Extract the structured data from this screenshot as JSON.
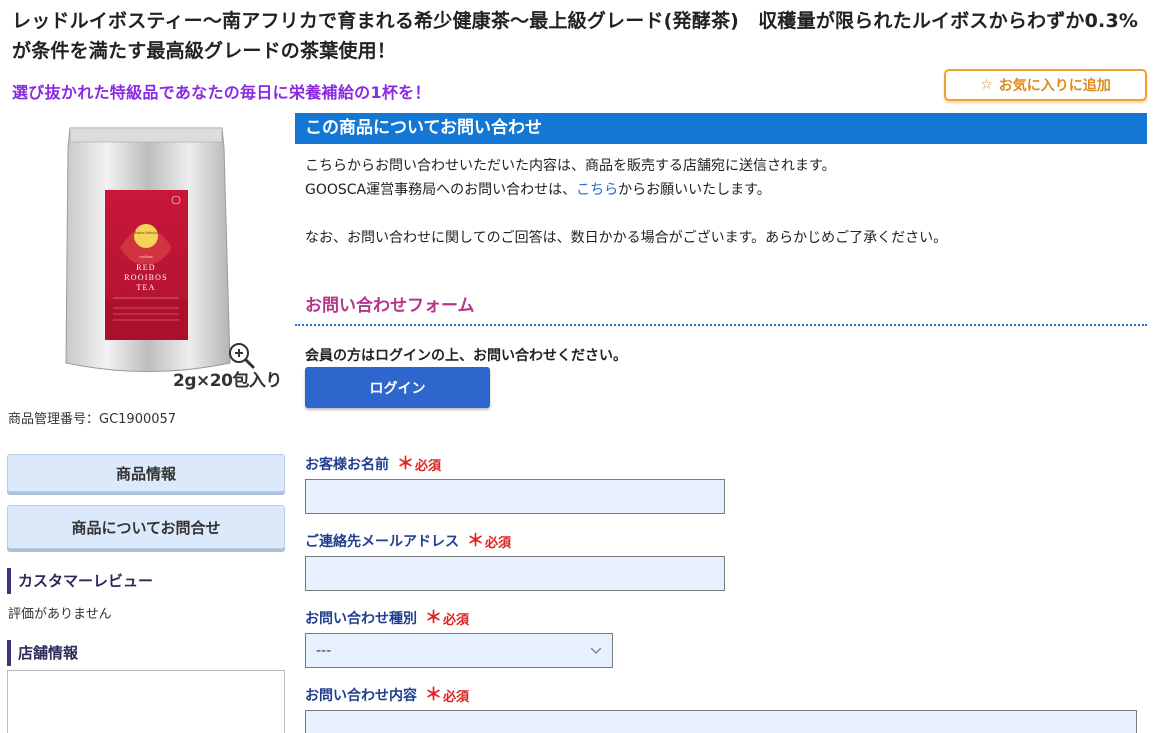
{
  "product": {
    "title": "レッドルイボスティー〜南アフリカで育まれる希少健康茶〜最上級グレード(発酵茶)　収穫量が限られたルイボスからわずか0.3%が条件を満たす最高級グレードの茶葉使用！",
    "catch_copy": "選び抜かれた特級品であなたの毎日に栄養補給の1杯を！",
    "management_no": "商品管理番号：GC1900057",
    "package": {
      "badge": "Masters Selection",
      "series": "rooibos",
      "line1": "RED",
      "line2": "ROOIBOS",
      "line3": "TEA",
      "count_label": "2g×20包入り"
    }
  },
  "favorite_button": {
    "icon": "star-outline-icon",
    "label": "お気に入りに追加"
  },
  "sidebar": {
    "product_info_button": "商品情報",
    "inquiry_button": "商品についてお問合せ",
    "review_heading": "カスタマーレビュー",
    "review_empty": "評価がありません",
    "store_heading": "店舗情報"
  },
  "main": {
    "header": "この商品についてお問い合わせ",
    "intro_line1": "こちらからお問い合わせいただいた内容は、商品を販売する店舗宛に送信されます。",
    "intro_line2_before": "GOOSCA運営事務局へのお問い合わせは、",
    "intro_line2_link": "こちら",
    "intro_line2_after": "からお願いいたします。",
    "intro_line3": "なお、お問い合わせに関してのご回答は、数日かかる場合がございます。あらかじめご了承ください。",
    "form_title": "お問い合わせフォーム",
    "member_note": "会員の方はログインの上、お問い合わせください。",
    "login_button": "ログイン"
  },
  "form": {
    "required_mark": "＊",
    "required_text": "必須",
    "name_label": "お客様お名前",
    "name_value": "",
    "email_label": "ご連絡先メールアドレス",
    "email_value": "",
    "type_label": "お問い合わせ種別",
    "type_selected": "---",
    "content_label": "お問い合わせ内容"
  },
  "colors": {
    "header_blue": "#1477d4",
    "form_title_magenta": "#b4358a",
    "catch_purple": "#8a2be2",
    "favorite_orange": "#f0a030",
    "required_red": "#e0231e",
    "input_bg": "#e6f0fe"
  }
}
